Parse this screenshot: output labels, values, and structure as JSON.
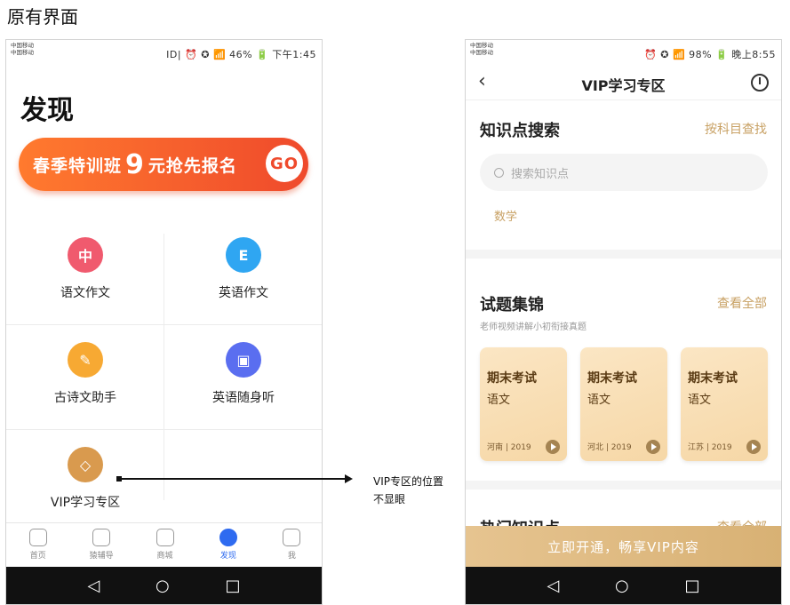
{
  "heading": "原有界面",
  "phone1": {
    "status": {
      "carrier1": "中国移动",
      "carrier2": "中国移动",
      "right": "ID| ⏰ ✪ 📶 46% 🔋 下午1:45"
    },
    "title": "发现",
    "banner": {
      "text1": "春季特训班",
      "num": "9",
      "text2": "元抢先报名",
      "go": "GO"
    },
    "items": [
      {
        "label": "语文作文",
        "glyph": "中",
        "color": "#f05a6e"
      },
      {
        "label": "英语作文",
        "glyph": "E",
        "color": "#2fa6f2"
      },
      {
        "label": "古诗文助手",
        "glyph": "✎",
        "color": "#f7a933"
      },
      {
        "label": "英语随身听",
        "glyph": "▣",
        "color": "#5a6ef0"
      },
      {
        "label": "VIP学习专区",
        "glyph": "◇",
        "color": "#d99a4e"
      }
    ],
    "tabs": [
      {
        "label": "首页",
        "icon": "home-icon"
      },
      {
        "label": "猿辅导",
        "icon": "play-icon"
      },
      {
        "label": "商城",
        "icon": "shop-icon"
      },
      {
        "label": "发现",
        "icon": "compass-icon",
        "active": true
      },
      {
        "label": "我",
        "icon": "profile-icon"
      }
    ]
  },
  "annotation": {
    "line1": "VIP专区的位置",
    "line2": "不显眼"
  },
  "phone2": {
    "status": {
      "carrier1": "中国移动",
      "carrier2": "中国移动",
      "right": "⏰ ✪ 📶 98% 🔋 晚上8:55"
    },
    "title": "VIP学习专区",
    "knowledge": {
      "title": "知识点搜索",
      "link": "按科目查找",
      "placeholder": "搜索知识点",
      "tag": "数学"
    },
    "exams": {
      "title": "试题集锦",
      "link": "查看全部",
      "sub": "老师视频讲解小初衔接真题"
    },
    "cards": [
      {
        "title": "期末考试",
        "subject": "语文",
        "meta": "河南 | 2019"
      },
      {
        "title": "期末考试",
        "subject": "语文",
        "meta": "河北 | 2019"
      },
      {
        "title": "期末考试",
        "subject": "语文",
        "meta": "江苏 | 2019"
      }
    ],
    "hot": {
      "title": "热门知识点",
      "link": "查看全部"
    },
    "cta": "立即开通，畅享VIP内容"
  },
  "nav": {
    "back": "◁",
    "home": "○",
    "recent": "□"
  }
}
